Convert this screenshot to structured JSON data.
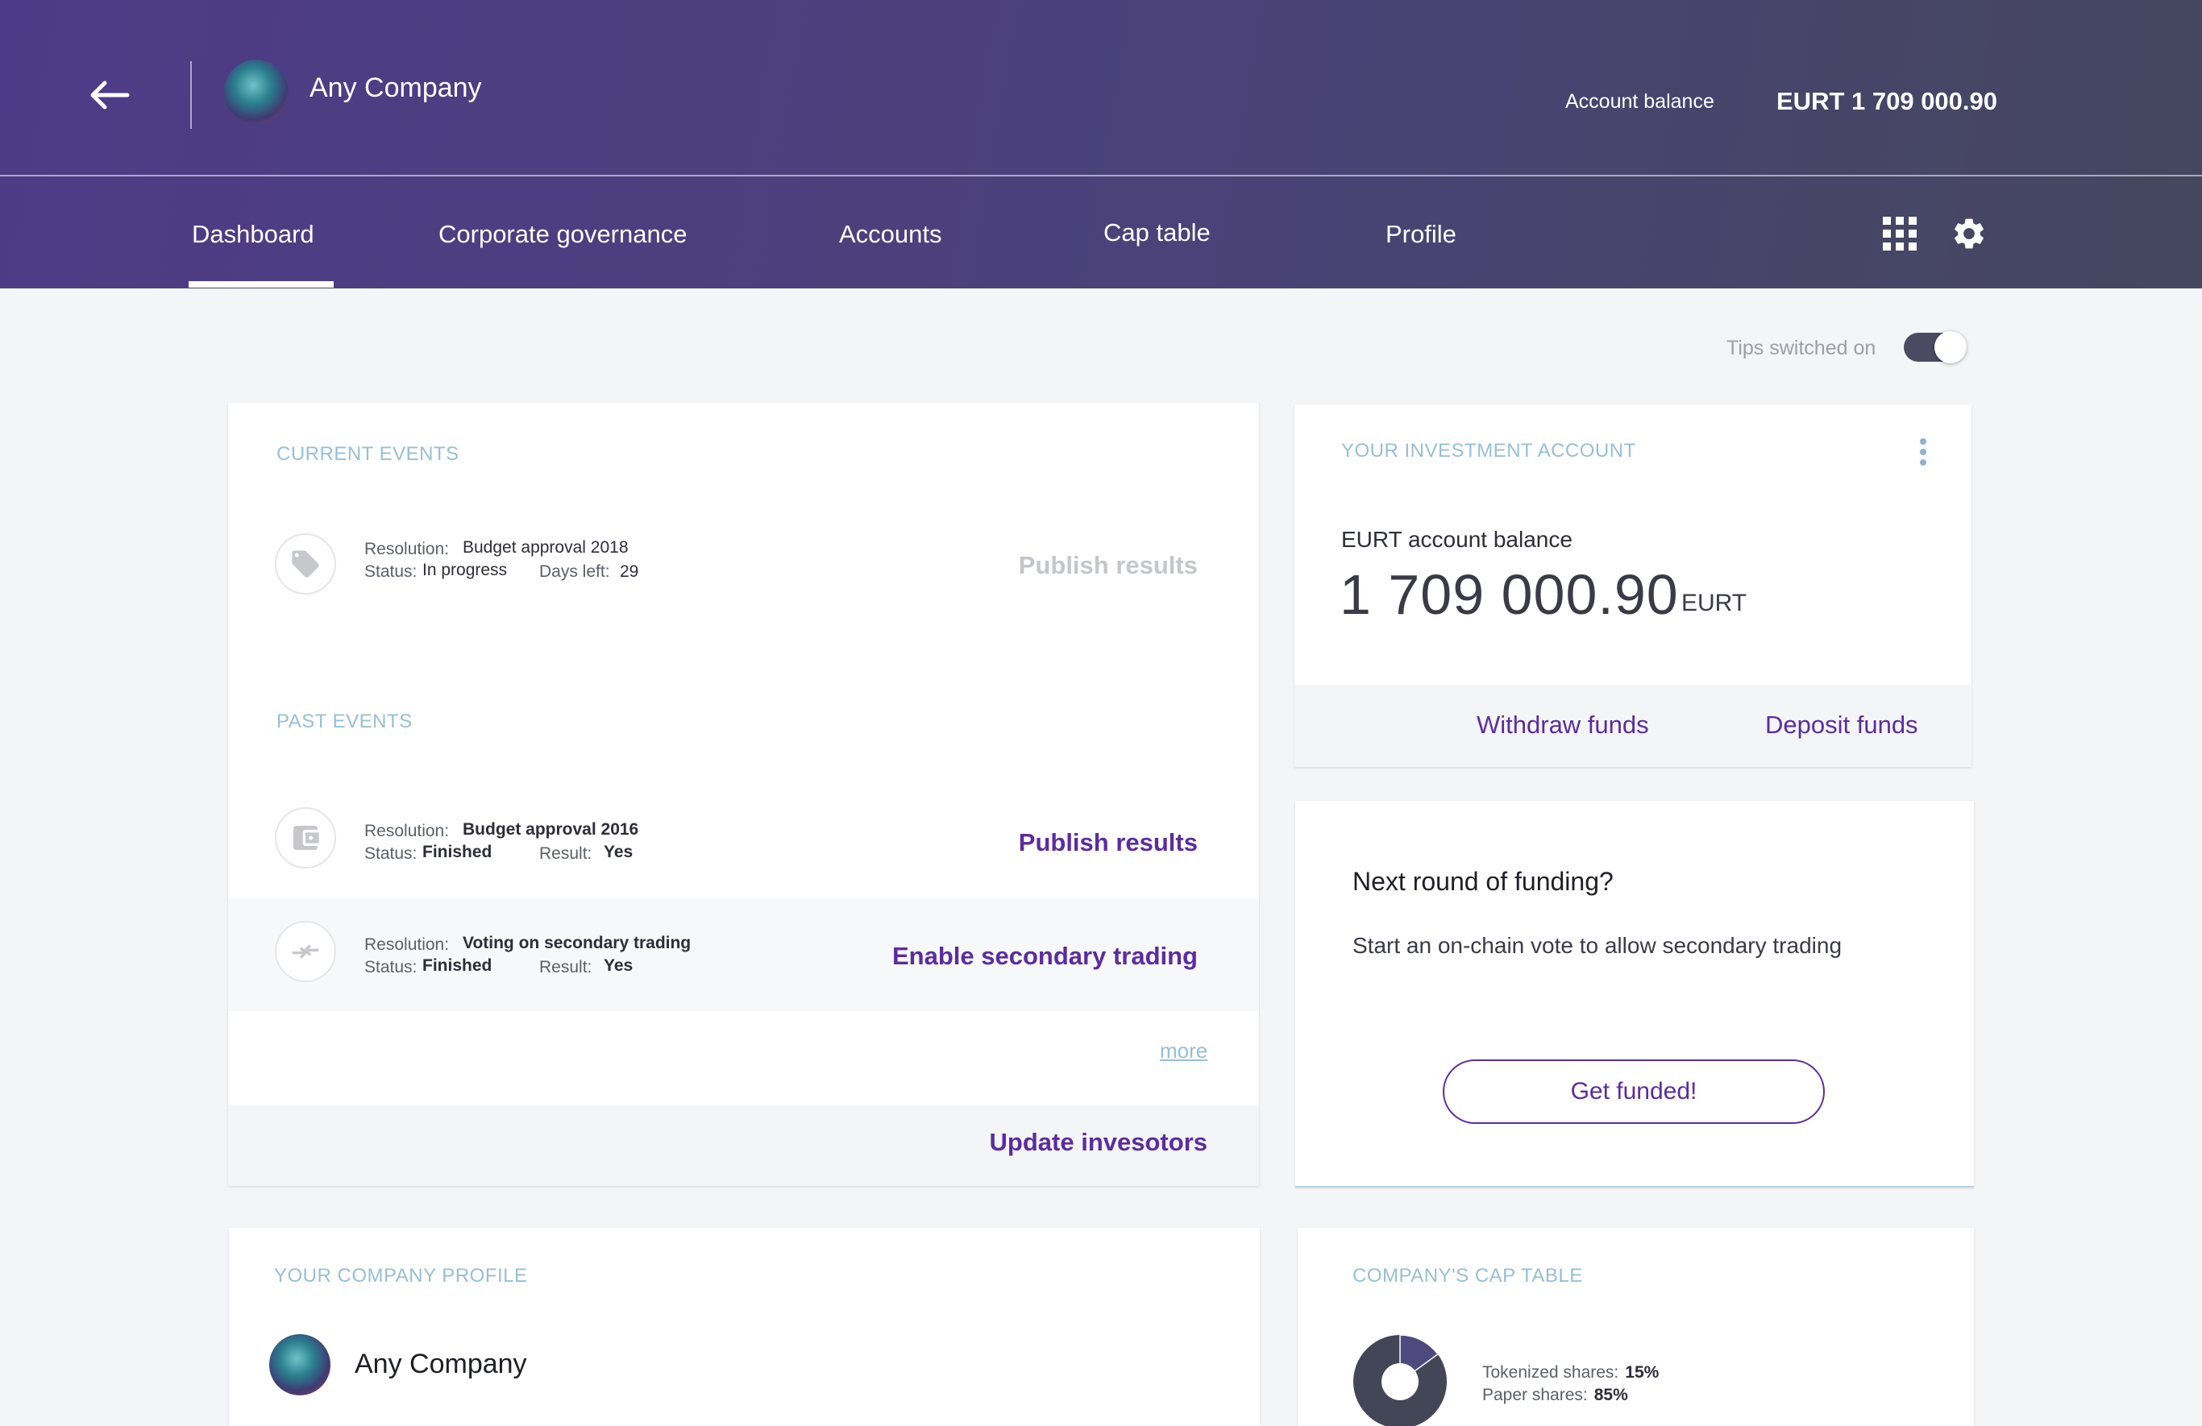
{
  "header": {
    "company_name": "Any Company",
    "balance_label": "Account balance",
    "balance_value": "EURT 1 709 000.90"
  },
  "nav": {
    "tabs": [
      "Dashboard",
      "Corporate governance",
      "Accounts",
      "Cap table",
      "Profile"
    ],
    "active_tab": "Dashboard",
    "icons": [
      "back-arrow-icon",
      "grid-icon",
      "gear-icon"
    ]
  },
  "tips": {
    "label": "Tips switched on",
    "enabled": true
  },
  "events": {
    "current_title": "CURRENT EVENTS",
    "past_title": "PAST EVENTS",
    "labels": {
      "resolution": "Resolution:",
      "status": "Status:",
      "days_left": "Days left:",
      "result": "Result:"
    },
    "current": [
      {
        "icon": "tag-icon",
        "resolution": "Budget approval 2018",
        "status": "In progress",
        "days_left": "29",
        "action": "Publish results"
      }
    ],
    "past": [
      {
        "icon": "wallet-icon",
        "resolution": "Budget approval 2016",
        "status": "Finished",
        "result": "Yes",
        "action": "Publish results"
      },
      {
        "icon": "exchange-icon",
        "resolution": "Voting on secondary trading",
        "status": "Finished",
        "result": "Yes",
        "action": "Enable secondary trading"
      }
    ],
    "more": "more",
    "footer_action": "Update invesotors"
  },
  "investment": {
    "title": "YOUR INVESTMENT ACCOUNT",
    "balance_label": "EURT account balance",
    "amount": "1 709 000.90",
    "unit": "EURT",
    "withdraw": "Withdraw funds",
    "deposit": "Deposit funds"
  },
  "funding": {
    "title": "Next round of funding?",
    "text": "Start an on-chain vote to allow secondary trading",
    "button": "Get funded!"
  },
  "profile": {
    "title": "YOUR COMPANY PROFILE",
    "company_name": "Any Company"
  },
  "captable": {
    "title": "COMPANY'S CAP TABLE",
    "tokenized_label": "Tokenized shares:",
    "tokenized_value": "15%",
    "paper_label": "Paper shares:",
    "paper_value": "85%",
    "tokenized_fraction": 0.15,
    "colors": {
      "tokenized": "#4e4a80",
      "paper": "#434657"
    }
  }
}
